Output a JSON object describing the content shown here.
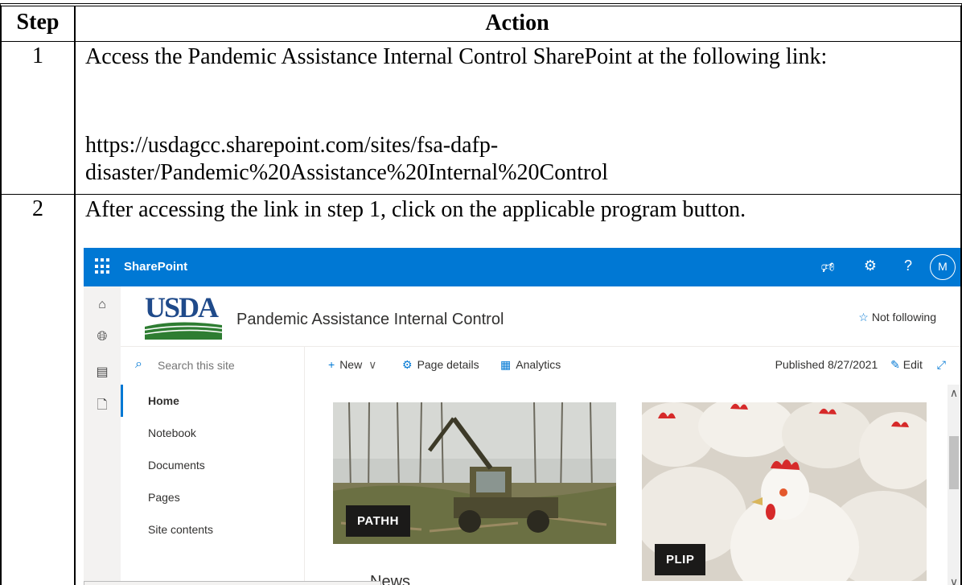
{
  "table": {
    "headers": {
      "step": "Step",
      "action": "Action"
    },
    "rows": [
      {
        "step": "1",
        "action_line1": "Access the Pandemic Assistance Internal Control SharePoint at the following link:",
        "link_line1": "https://usdagcc.sharepoint.com/sites/fsa-dafp-",
        "link_line2": "disaster/Pandemic%20Assistance%20Internal%20Control"
      },
      {
        "step": "2",
        "action_line1": "After accessing the link in step 1, click on the applicable program button."
      }
    ]
  },
  "sharepoint": {
    "brand": "SharePoint",
    "avatar_initial": "M",
    "logo_text": "USDA",
    "site_title": "Pandemic Assistance Internal Control",
    "follow_label": "Not following",
    "search_placeholder": "Search this site",
    "commands": {
      "new": "New",
      "page_details": "Page details",
      "analytics": "Analytics"
    },
    "published": "Published 8/27/2021",
    "edit": "Edit",
    "nav": [
      "Home",
      "Notebook",
      "Documents",
      "Pages",
      "Site contents"
    ],
    "tiles": [
      "PATHH",
      "PLIP"
    ],
    "news_heading": "News",
    "icons": {
      "waffle": "app-launcher-icon",
      "megaphone": "megaphone-icon",
      "settings": "gear-icon",
      "help": "help-icon"
    },
    "colors": {
      "suite_bar": "#0078d4",
      "tile_label": "#1b1a19",
      "usda_blue": "#1f4a8a",
      "usda_green": "#2e7d32"
    }
  }
}
